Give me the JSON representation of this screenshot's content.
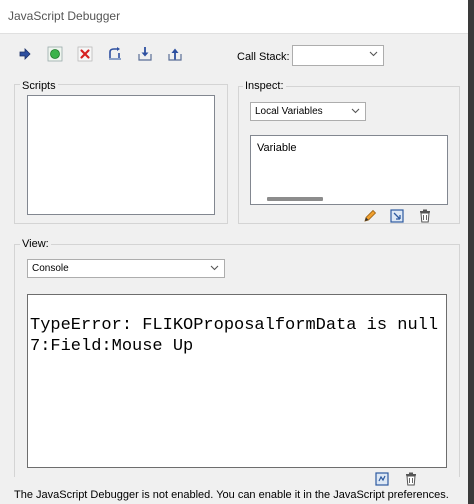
{
  "window": {
    "title": "JavaScript Debugger"
  },
  "toolbar": {
    "buttons": [
      {
        "icon": "step-arrow-icon"
      },
      {
        "icon": "resume-icon"
      },
      {
        "icon": "stop-icon"
      },
      {
        "icon": "step-over-icon"
      },
      {
        "icon": "step-into-icon"
      },
      {
        "icon": "step-out-icon"
      }
    ],
    "call_stack_label": "Call Stack:",
    "call_stack_value": ""
  },
  "scripts": {
    "label": "Scripts"
  },
  "inspect": {
    "label": "Inspect:",
    "selected": "Local Variables",
    "column_header": "Variable",
    "icons": [
      "pencil-icon",
      "watch-icon",
      "trash-icon"
    ]
  },
  "view": {
    "label": "View:",
    "selected": "Console",
    "console_text": "TypeError: FLIKOProposalformData is null\n7:Field:Mouse Up",
    "icons": [
      "clear-console-icon",
      "trash-icon"
    ]
  },
  "status": {
    "message": "The JavaScript Debugger is not enabled. You can enable it in the JavaScript preferences."
  }
}
